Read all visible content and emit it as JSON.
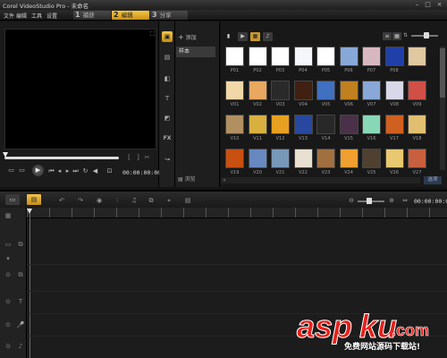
{
  "window": {
    "title": "Corel VideoStudio Pro - 未命名",
    "controls": [
      "minimize-icon",
      "maximize-icon",
      "close-icon"
    ]
  },
  "menu": {
    "items": [
      "文件",
      "编辑",
      "工具",
      "设置"
    ]
  },
  "steps": [
    {
      "num": "1",
      "label": "捕获",
      "active": false
    },
    {
      "num": "2",
      "label": "编辑",
      "active": true
    },
    {
      "num": "3",
      "label": "分享",
      "active": false
    }
  ],
  "preview": {
    "timecode": "00:00:00:00",
    "controls": [
      "play-icon",
      "home-icon",
      "prev-frame-icon",
      "next-frame-icon",
      "end-icon",
      "repeat-icon",
      "volume-icon",
      "fit-icon"
    ]
  },
  "library": {
    "add_label": "添加",
    "folder_name": "样本",
    "browse_label": "浏览",
    "options_label": "选项",
    "tools": [
      "media-icon",
      "instant-project-icon",
      "transition-icon",
      "title-icon",
      "graphic-icon",
      "filter-icon",
      "path-icon"
    ],
    "filters": [
      "folder-icon",
      "video-filter-icon",
      "photo-filter-icon",
      "audio-filter-icon"
    ],
    "thumbnail_labels": [
      [
        "P01",
        "P02",
        "P03",
        "P04",
        "P05",
        "P06",
        "P07",
        "P08"
      ],
      [
        "V01",
        "V02",
        "V03",
        "V04",
        "V05",
        "V06",
        "V07",
        "V08",
        "V09"
      ],
      [
        "V10",
        "V11",
        "V12",
        "V13",
        "V14",
        "V15",
        "V16",
        "V17",
        "V18"
      ],
      [
        "V19",
        "V20",
        "V21",
        "V22",
        "V23",
        "V24",
        "V25",
        "V26",
        "V27"
      ]
    ],
    "thumbnail_colors": [
      [
        "#ffffff",
        "#ffffff",
        "#ffffff",
        "#f4f6fb",
        "#ffffff",
        "#88a8d8",
        "#d8b8c0",
        "#2040a8",
        "#e0c8a0"
      ],
      [
        "#f0d8a8",
        "#e8a860",
        "#2a2a2a",
        "#402010",
        "#4070c0",
        "#c08020",
        "#88a8d8",
        "#d8d8e8",
        "#d05048"
      ],
      [
        "#b09060",
        "#d8b040",
        "#e8a020",
        "#2848a0",
        "#282828",
        "#4a3048",
        "#88d8b8",
        "#d06020",
        "#e0c070"
      ],
      [
        "#c85010",
        "#6888c0",
        "#7898b8",
        "#e8e0d0",
        "#a07040",
        "#f0a030",
        "#504030",
        "#e8c870",
        "#c86040"
      ]
    ]
  },
  "timeline": {
    "timecode": "00:00:00:00",
    "views": [
      "storyboard-view-icon",
      "timeline-view-icon"
    ],
    "tools": [
      "undo-icon",
      "redo-icon",
      "record-icon",
      "mixer-icon",
      "auto-music-icon",
      "split-icon",
      "motion-icon",
      "subtitle-icon"
    ],
    "tracks": [
      "video-track-icon",
      "overlay-track-icon",
      "title-track-icon",
      "voice-track-icon",
      "music-track-icon"
    ]
  },
  "watermark": {
    "logo": "aspku",
    "slogan": "免费网站源码下载站!"
  }
}
